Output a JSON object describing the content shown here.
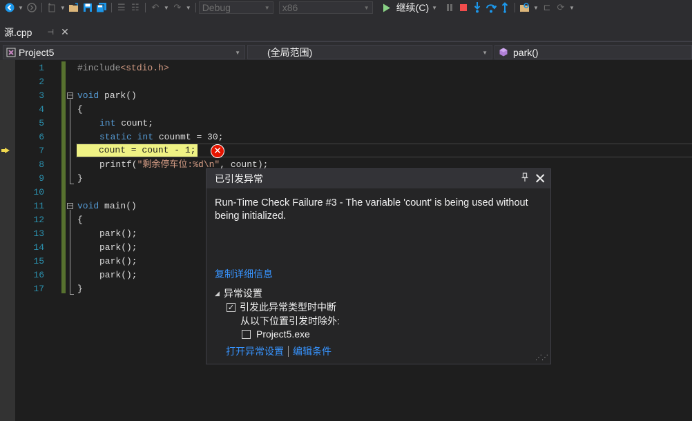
{
  "toolbar": {
    "config": "Debug",
    "platform": "x86",
    "continue_label": "继续(C)"
  },
  "tabs": [
    {
      "label": "源.cpp"
    }
  ],
  "navbar": {
    "project": "Project5",
    "scope": "(全局范围)",
    "member": "park()"
  },
  "editor": {
    "line_numbers": [
      "1",
      "2",
      "3",
      "4",
      "5",
      "6",
      "7",
      "8",
      "9",
      "10",
      "11",
      "12",
      "13",
      "14",
      "15",
      "16",
      "17"
    ],
    "lines": {
      "l1_a": "#include",
      "l1_b": "<stdio.h>",
      "l3_a": "void",
      "l3_b": " park()",
      "l4": "{",
      "l5_a": "int",
      "l5_b": " count;",
      "l6_a": "static",
      "l6_b": " ",
      "l6_c": "int",
      "l6_d": " counmt = 30;",
      "l7": "count = count - 1;",
      "l8_a": "printf(",
      "l8_b": "\"剩余停车位:%d\\n\"",
      "l8_c": ", count);",
      "l9": "}",
      "l11_a": "void",
      "l11_b": " main()",
      "l12": "{",
      "l13": "park();",
      "l14": "park();",
      "l15": "park();",
      "l16": "park();",
      "l17": "}"
    }
  },
  "exception": {
    "title": "已引发异常",
    "message": "Run-Time Check Failure #3 - The variable 'count' is being used without being initialized.",
    "copy_details": "复制详细信息",
    "settings_header": "异常设置",
    "break_when_thrown": "引发此异常类型时中断",
    "break_checked": true,
    "except_when_from": "从以下位置引发时除外:",
    "module": "Project5.exe",
    "module_checked": false,
    "open_settings": "打开异常设置",
    "edit_conditions": "编辑条件"
  },
  "colors": {
    "accent_link": "#3794ff",
    "keyword": "#569cd6",
    "string": "#d69d85",
    "line_number": "#2b91af",
    "current_statement": "#eff284",
    "error": "#e51400",
    "change_bar": "#57712f"
  }
}
